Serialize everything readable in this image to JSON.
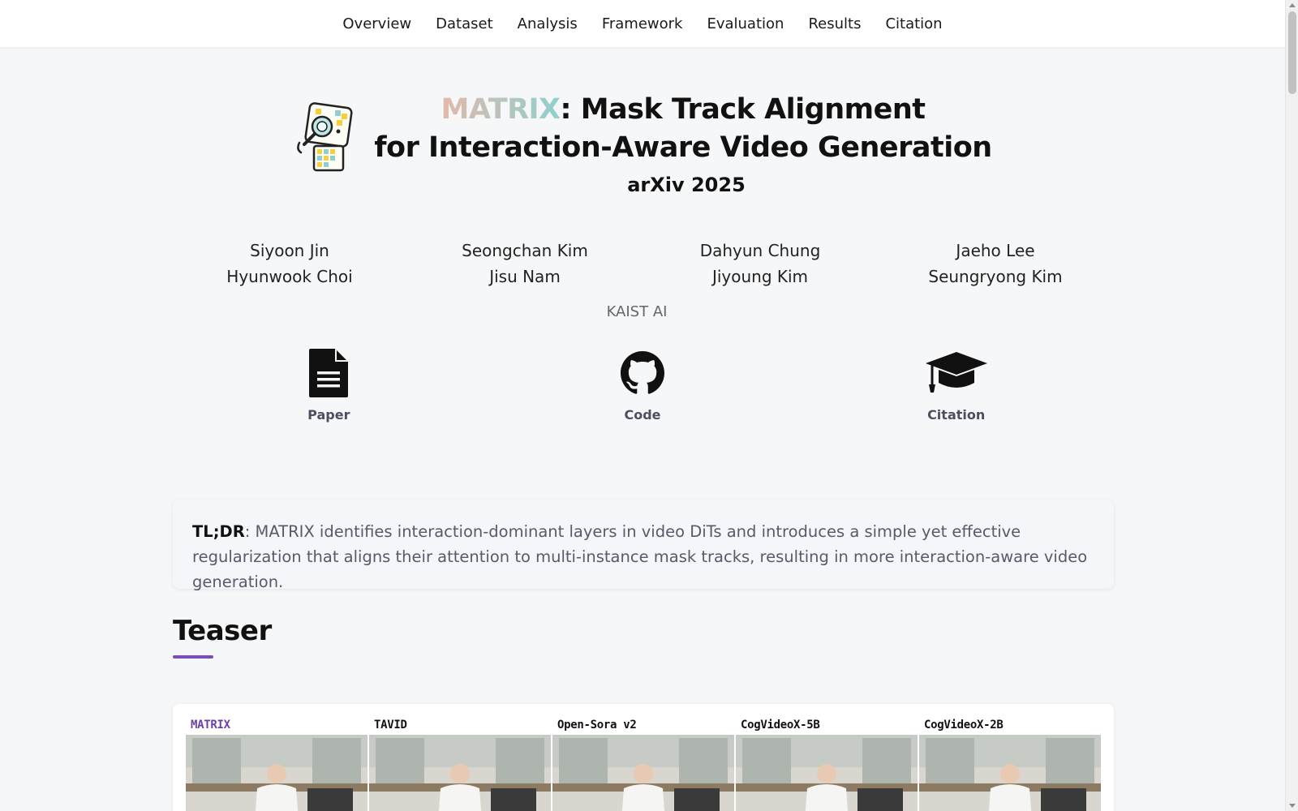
{
  "nav": {
    "items": [
      "Overview",
      "Dataset",
      "Analysis",
      "Framework",
      "Evaluation",
      "Results",
      "Citation"
    ]
  },
  "title": {
    "matrix": "MATRIX",
    "line1_rest": ": Mask Track Alignment",
    "line2": "for Interaction-Aware Video Generation",
    "venue": "arXiv 2025"
  },
  "authors": [
    "Siyoon Jin",
    "Seongchan Kim",
    "Dahyun Chung",
    "Jaeho Lee",
    "Hyunwook Choi",
    "Jisu Nam",
    "Jiyoung Kim",
    "Seungryong Kim"
  ],
  "affiliation": "KAIST AI",
  "links": {
    "paper": "Paper",
    "code": "Code",
    "citation": "Citation"
  },
  "tldr": {
    "label": "TL;DR",
    "text": ": MATRIX identifies interaction-dominant layers in video DiTs and introduces a simple yet effective regularization that aligns their attention to multi-instance mask tracks, resulting in more interaction-aware video generation."
  },
  "teaser": {
    "heading": "Teaser",
    "methods": [
      "MATRIX",
      "TAVID",
      "Open-Sora v2",
      "CogVideoX-5B",
      "CogVideoX-2B"
    ]
  },
  "colors": {
    "accent": "#7a4fb5",
    "matrix_gradient": [
      "#e3b8a8",
      "#8fd0cf"
    ]
  }
}
